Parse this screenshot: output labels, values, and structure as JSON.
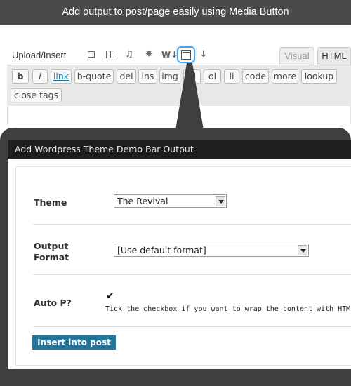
{
  "banner": {
    "text": "Add output to post/page easily using Media Button"
  },
  "editor": {
    "upload_label": "Upload/Insert",
    "media_icons": [
      "image-icon",
      "gallery-icon",
      "audio-icon",
      "media-icon",
      "wordpress-icon",
      "theme-demo-bar-icon",
      "download-icon"
    ],
    "tabs": {
      "visual": "Visual",
      "html": "HTML"
    },
    "quicktags": [
      "b",
      "i",
      "link",
      "b-quote",
      "del",
      "ins",
      "img",
      "ul",
      "ol",
      "li",
      "code",
      "more",
      "lookup",
      "close tags"
    ]
  },
  "dialog": {
    "title": "Add Wordpress Theme Demo Bar Output",
    "theme": {
      "label": "Theme",
      "value": "The Revival"
    },
    "output_format": {
      "label": "Output Format",
      "value": "[Use default format]"
    },
    "auto_p": {
      "label": "Auto P?",
      "checked": true,
      "check_glyph": "✔",
      "hint": "Tick the checkbox if you want to wrap the content with HTML"
    },
    "insert_button": "Insert into post"
  },
  "colors": {
    "banner": "#4a4a4a",
    "frame": "#3f3f3f",
    "title_bar": "#1e1e1e",
    "button": "#21759b",
    "highlight": "#4aa3e8"
  }
}
